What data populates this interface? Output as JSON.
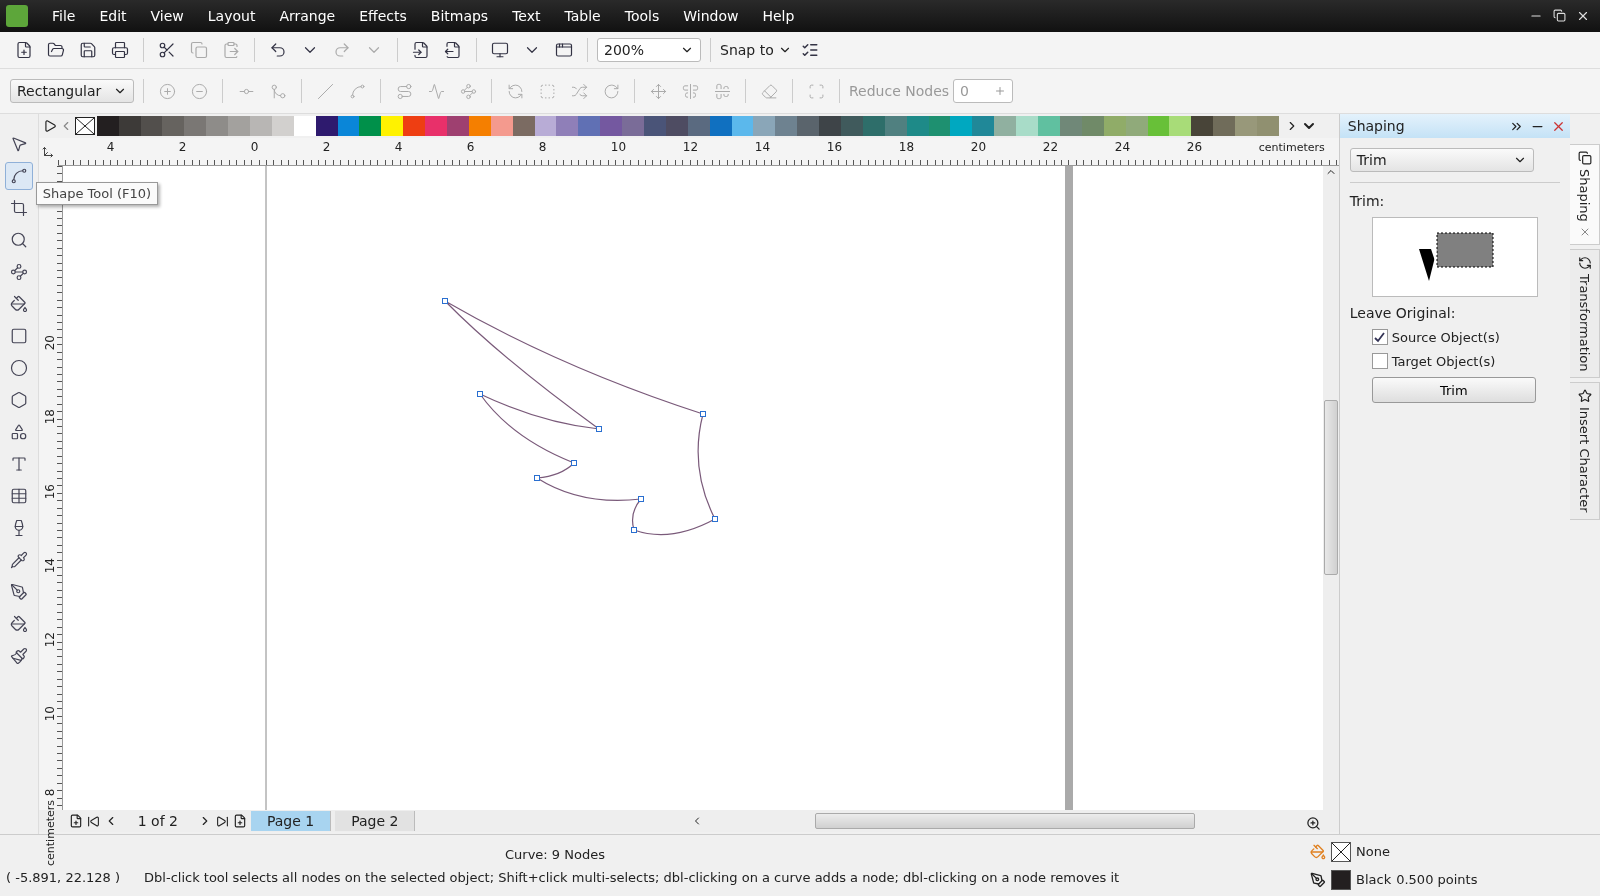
{
  "menu": [
    "File",
    "Edit",
    "View",
    "Layout",
    "Arrange",
    "Effects",
    "Bitmaps",
    "Text",
    "Table",
    "Tools",
    "Window",
    "Help"
  ],
  "standard_toolbar": {
    "zoom": "200%",
    "snap": "Snap to"
  },
  "property_bar": {
    "mode": "Rectangular",
    "reduce_nodes_label": "Reduce Nodes",
    "reduce_nodes_value": "0"
  },
  "palette": [
    {
      "color": "#231f20"
    },
    {
      "color": "#3d3a38"
    },
    {
      "color": "#524f4c"
    },
    {
      "color": "#66635f"
    },
    {
      "color": "#7a7774"
    },
    {
      "color": "#8e8c89"
    },
    {
      "color": "#a3a19e"
    },
    {
      "color": "#b8b6b4"
    },
    {
      "color": "#d2d0ce"
    },
    {
      "color": "#ffffff"
    },
    {
      "color": "#2e1a6e"
    },
    {
      "color": "#0a86d8"
    },
    {
      "color": "#00904a"
    },
    {
      "color": "#fff200"
    },
    {
      "color": "#ee3e12"
    },
    {
      "color": "#e8306a"
    },
    {
      "color": "#9e4070"
    },
    {
      "color": "#f57f00"
    },
    {
      "color": "#f49a8e"
    },
    {
      "color": "#7b6b62"
    },
    {
      "color": "#b8acd6"
    },
    {
      "color": "#8f7fb8"
    },
    {
      "color": "#6070b4"
    },
    {
      "color": "#7458a0"
    },
    {
      "color": "#7a6c98"
    },
    {
      "color": "#4a5478"
    },
    {
      "color": "#4e4c62"
    },
    {
      "color": "#5a6a80"
    },
    {
      "color": "#1070c0"
    },
    {
      "color": "#5bb8ec"
    },
    {
      "color": "#8aa6b8"
    },
    {
      "color": "#6e8290"
    },
    {
      "color": "#5a646c"
    },
    {
      "color": "#3e4448"
    },
    {
      "color": "#405a5c"
    },
    {
      "color": "#2e6e6a"
    },
    {
      "color": "#508080"
    },
    {
      "color": "#1e8a88"
    },
    {
      "color": "#1e9070"
    },
    {
      "color": "#00a8c0"
    },
    {
      "color": "#208898"
    },
    {
      "color": "#90b0a0"
    },
    {
      "color": "#a8dcc8"
    },
    {
      "color": "#60c0a0"
    },
    {
      "color": "#708878"
    },
    {
      "color": "#708a68"
    },
    {
      "color": "#90ac68"
    },
    {
      "color": "#90aa7a"
    },
    {
      "color": "#68c038"
    },
    {
      "color": "#a8dc78"
    },
    {
      "color": "#484438"
    },
    {
      "color": "#706c5a"
    },
    {
      "color": "#98987a"
    },
    {
      "color": "#909070"
    }
  ],
  "ruler_h": {
    "labels": [
      "4",
      "2",
      "0",
      "2",
      "4",
      "6",
      "8",
      "10",
      "12",
      "14",
      "16",
      "18",
      "20",
      "22",
      "24",
      "26"
    ],
    "unit": "centimeters"
  },
  "ruler_v": {
    "labels": [
      "20",
      "18",
      "16",
      "14",
      "12",
      "10",
      "8"
    ],
    "unit": "centimeters"
  },
  "tools": [
    {
      "kind": "pick",
      "selected": false
    },
    {
      "kind": "shape",
      "selected": true
    },
    {
      "kind": "crop",
      "selected": false
    },
    {
      "kind": "zoom",
      "selected": false
    },
    {
      "kind": "curve",
      "selected": false
    },
    {
      "kind": "smartfill",
      "selected": false
    },
    {
      "kind": "rectangle",
      "selected": false
    },
    {
      "kind": "ellipse",
      "selected": false
    },
    {
      "kind": "polygon",
      "selected": false
    },
    {
      "kind": "shapes",
      "selected": false
    },
    {
      "kind": "text",
      "selected": false
    },
    {
      "kind": "table",
      "selected": false
    },
    {
      "kind": "blend",
      "selected": false
    },
    {
      "kind": "eyedropper",
      "selected": false
    },
    {
      "kind": "outline",
      "selected": false
    },
    {
      "kind": "fill",
      "selected": false
    },
    {
      "kind": "interactivefill",
      "selected": false
    }
  ],
  "tooltip": "Shape Tool (F10)",
  "docker": {
    "title": "Shaping",
    "operation": "Trim",
    "section": "Trim:",
    "leave_original": "Leave Original:",
    "options": [
      {
        "label": "Source Object(s)",
        "checked": true
      },
      {
        "label": "Target Object(s)",
        "checked": false
      }
    ],
    "apply": "Trim"
  },
  "docker_tabs": [
    {
      "label": "Shaping",
      "selected": true
    },
    {
      "label": "Transformation",
      "selected": false
    },
    {
      "label": "Insert Character",
      "selected": false
    }
  ],
  "page_nav": {
    "position": "1 of 2",
    "pages": [
      {
        "label": "Page 1",
        "selected": true
      },
      {
        "label": "Page 2",
        "selected": false
      }
    ]
  },
  "status": {
    "object": "Curve: 9 Nodes",
    "coords": "( -5.891, 22.128 )",
    "hint": "Dbl-click tool selects all nodes on the selected object; Shift+click multi-selects; dbl-clicking on a curve adds a node; dbl-clicking on a node removes it",
    "fill": {
      "kind": "none",
      "label": "None"
    },
    "outline": {
      "label": "Black",
      "color": "#231f20",
      "width": "0.500 points"
    }
  }
}
